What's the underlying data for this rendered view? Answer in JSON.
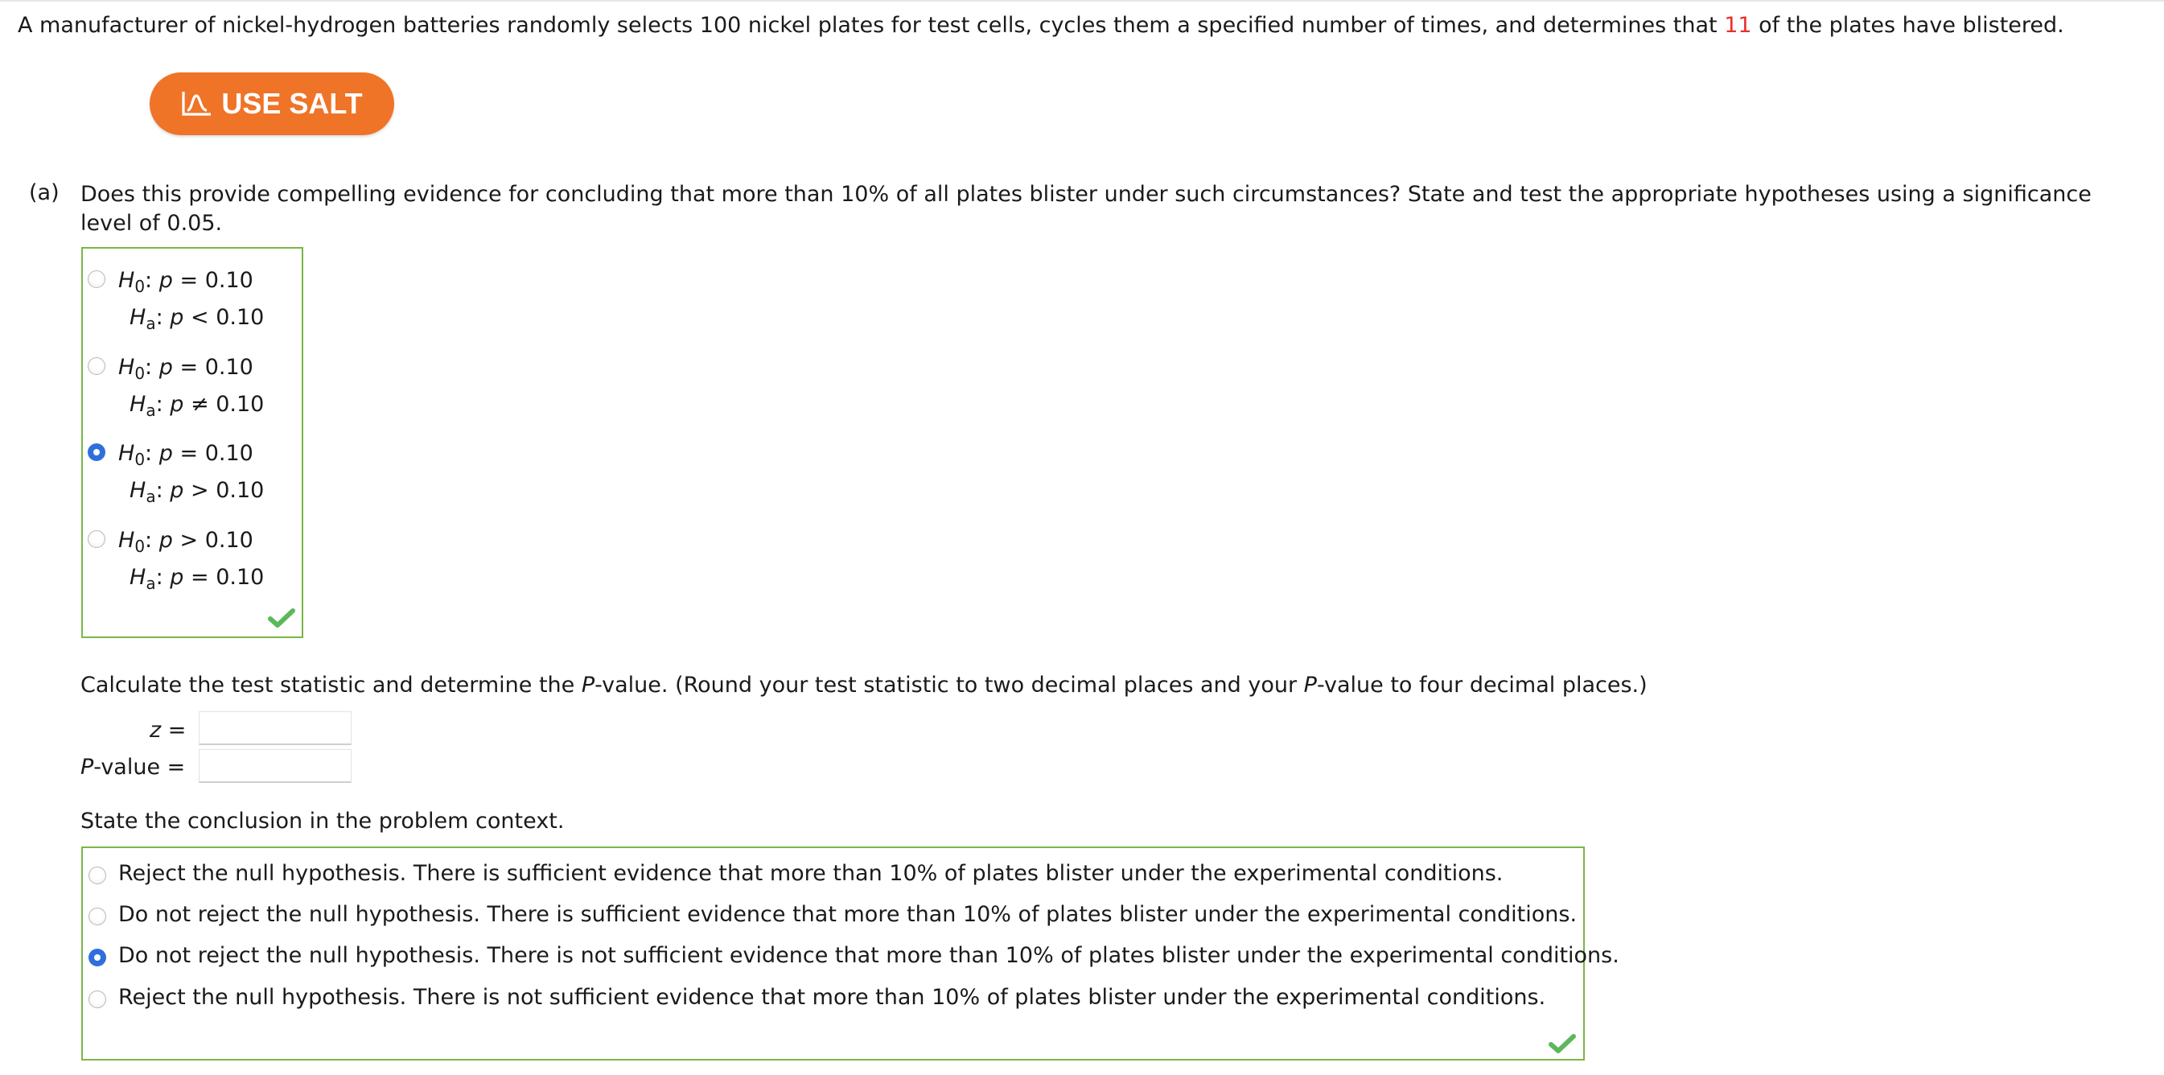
{
  "intro": {
    "text_before": "A manufacturer of nickel-hydrogen batteries randomly selects 100 nickel plates for test cells, cycles them a specified number of times, and determines that ",
    "highlight": "11",
    "text_after": " of the plates have blistered."
  },
  "salt_button": {
    "label": "USE SALT",
    "icon": "salt-chart-icon"
  },
  "part_a": {
    "label": "(a)",
    "question": "Does this provide compelling evidence for concluding that more than 10% of all plates blister under such circumstances? State and test the appropriate hypotheses using a significance level of 0.05.",
    "hypothesis_options": [
      {
        "h0_rel": "=",
        "h0_val": "0.10",
        "ha_rel": "<",
        "ha_val": "0.10",
        "selected": false
      },
      {
        "h0_rel": "=",
        "h0_val": "0.10",
        "ha_rel": "≠",
        "ha_val": "0.10",
        "selected": false
      },
      {
        "h0_rel": "=",
        "h0_val": "0.10",
        "ha_rel": ">",
        "ha_val": "0.10",
        "selected": true
      },
      {
        "h0_rel": ">",
        "h0_val": "0.10",
        "ha_rel": "=",
        "ha_val": "0.10",
        "selected": false
      }
    ],
    "h_symbol": "H",
    "h0_sub": "0",
    "ha_sub": "a",
    "param": "p",
    "calc_prompt_1": "Calculate the test statistic and determine the ",
    "calc_prompt_p": "P",
    "calc_prompt_2": "-value. (Round your test statistic to two decimal places and your ",
    "calc_prompt_p2": "P",
    "calc_prompt_3": "-value to four decimal places.)",
    "z_label": "z",
    "equals": "=",
    "pvalue_label_p": "P",
    "pvalue_label_rest": "-value",
    "z_value": "",
    "p_value": "",
    "conclusion_prompt": "State the conclusion in the problem context.",
    "conclusion_options": [
      {
        "text": "Reject the null hypothesis. There is sufficient evidence that more than 10% of plates blister under the experimental conditions.",
        "selected": false
      },
      {
        "text": "Do not reject the null hypothesis. There is sufficient evidence that more than 10% of plates blister under the experimental conditions.",
        "selected": false
      },
      {
        "text": "Do not reject the null hypothesis. There is not sufficient evidence that more than 10% of plates blister under the experimental conditions.",
        "selected": true
      },
      {
        "text": "Reject the null hypothesis. There is not sufficient evidence that more than 10% of plates blister under the experimental conditions.",
        "selected": false
      }
    ]
  },
  "colors": {
    "accent": "#ef7428",
    "correct_border": "#7ab648",
    "radio_selected": "#2f6fdb",
    "highlight": "#e8312a",
    "checkmark": "#5cb85c"
  }
}
